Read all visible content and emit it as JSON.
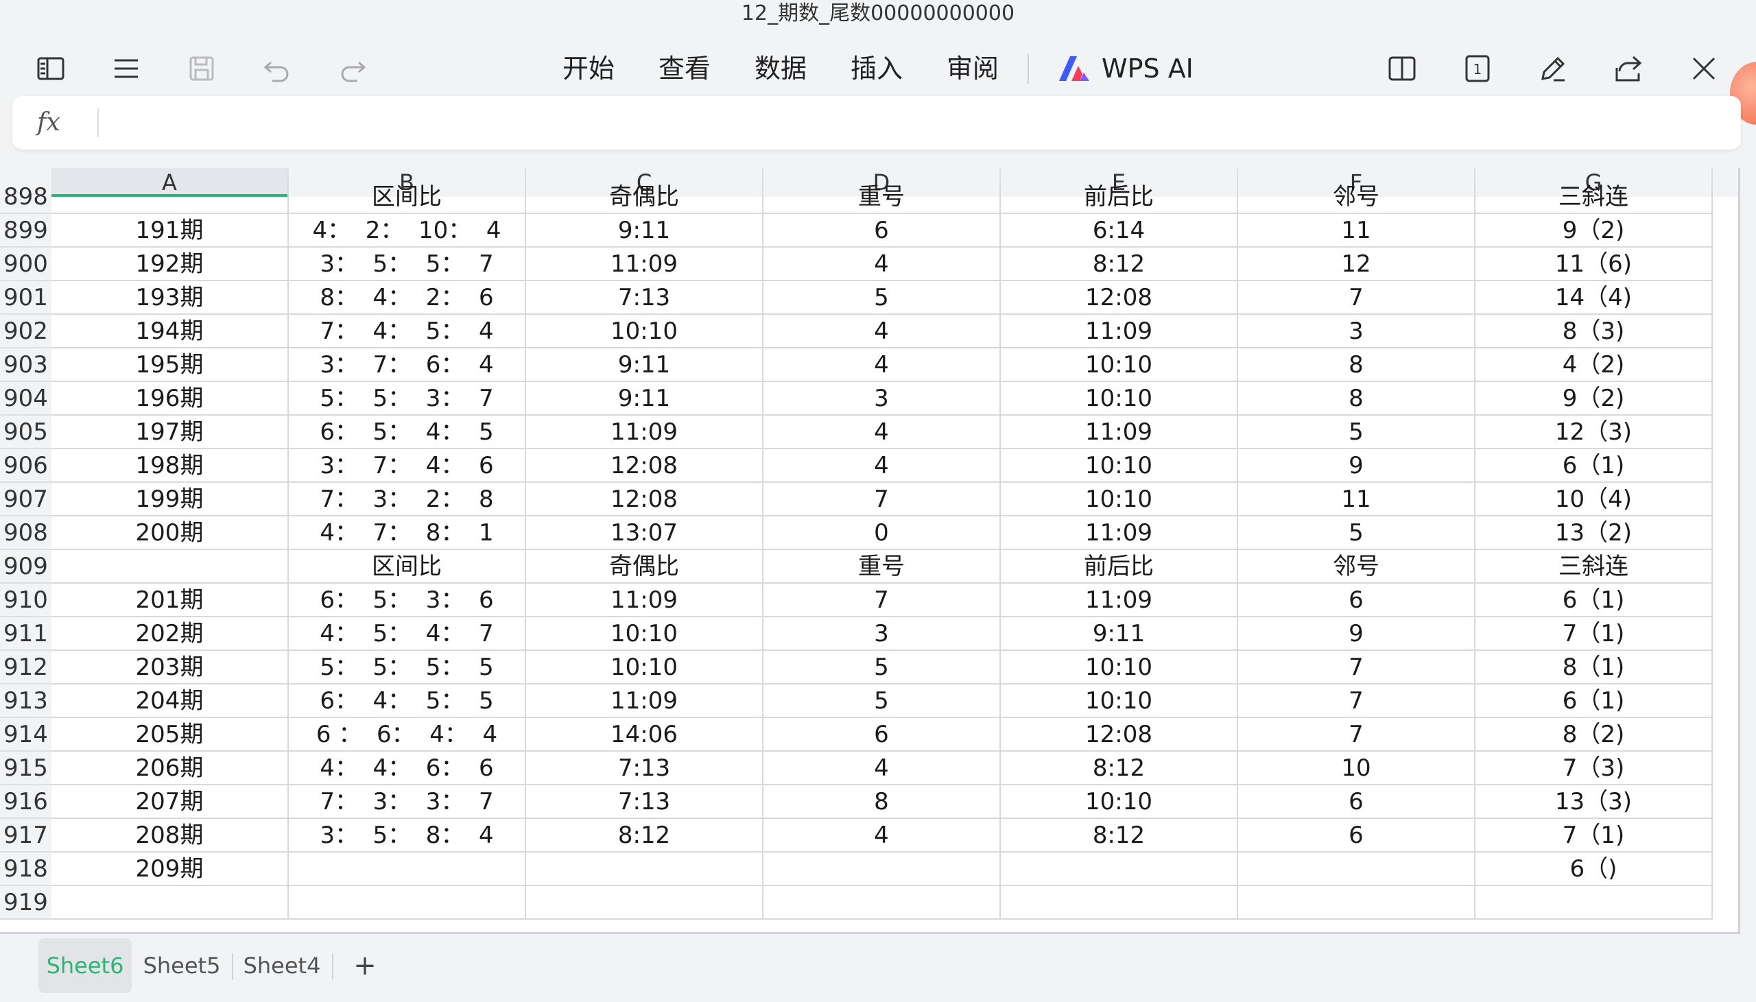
{
  "window": {
    "title": "12_期数_尾数00000000000"
  },
  "toolbar": {
    "menus": [
      "开始",
      "查看",
      "数据",
      "插入",
      "审阅"
    ],
    "ai_label": "WPS AI",
    "page_indicator": "1"
  },
  "formula": {
    "fx": "fx",
    "value": ""
  },
  "columns": [
    "A",
    "B",
    "C",
    "D",
    "E",
    "F",
    "G"
  ],
  "rows": [
    {
      "num": "898",
      "cells": [
        "",
        "区间比",
        "奇偶比",
        "重号",
        "前后比",
        "邻号",
        "三斜连"
      ]
    },
    {
      "num": "899",
      "cells": [
        "191期",
        "4：  2：  10：  4",
        "9:11",
        "6",
        "6:14",
        "11",
        "9（2)"
      ]
    },
    {
      "num": "900",
      "cells": [
        "192期",
        "3：  5：  5：  7",
        "11:09",
        "4",
        "8:12",
        "12",
        "11（6)"
      ]
    },
    {
      "num": "901",
      "cells": [
        "193期",
        "8：  4：  2：  6",
        "7:13",
        "5",
        "12:08",
        "7",
        "14（4)"
      ]
    },
    {
      "num": "902",
      "cells": [
        "194期",
        "7：  4：  5：  4",
        "10:10",
        "4",
        "11:09",
        "3",
        "8（3)"
      ]
    },
    {
      "num": "903",
      "cells": [
        "195期",
        "3：  7：  6：  4",
        "9:11",
        "4",
        "10:10",
        "8",
        "4（2)"
      ]
    },
    {
      "num": "904",
      "cells": [
        "196期",
        "5：  5：  3：  7",
        "9:11",
        "3",
        "10:10",
        "8",
        "9（2)"
      ]
    },
    {
      "num": "905",
      "cells": [
        "197期",
        "6：  5：  4：  5",
        "11:09",
        "4",
        "11:09",
        "5",
        "12（3)"
      ]
    },
    {
      "num": "906",
      "cells": [
        "198期",
        "3：  7：  4：  6",
        "12:08",
        "4",
        "10:10",
        "9",
        "6（1)"
      ]
    },
    {
      "num": "907",
      "cells": [
        "199期",
        "7：  3：  2：  8",
        "12:08",
        "7",
        "10:10",
        "11",
        "10（4)"
      ]
    },
    {
      "num": "908",
      "cells": [
        "200期",
        "4：  7：  8：  1",
        "13:07",
        "0",
        "11:09",
        "5",
        "13（2)"
      ]
    },
    {
      "num": "909",
      "cells": [
        "",
        "区间比",
        "奇偶比",
        "重号",
        "前后比",
        "邻号",
        "三斜连"
      ]
    },
    {
      "num": "910",
      "cells": [
        "201期",
        "6：  5：  3：  6",
        "11:09",
        "7",
        "11:09",
        "6",
        "6（1)"
      ]
    },
    {
      "num": "911",
      "cells": [
        "202期",
        "4：  5：  4：  7",
        "10:10",
        "3",
        "9:11",
        "9",
        "7（1)"
      ]
    },
    {
      "num": "912",
      "cells": [
        "203期",
        "5：  5：  5：  5",
        "10:10",
        "5",
        "10:10",
        "7",
        "8（1)"
      ]
    },
    {
      "num": "913",
      "cells": [
        "204期",
        "6：  4：  5：  5",
        "11:09",
        "5",
        "10:10",
        "7",
        "6（1)"
      ]
    },
    {
      "num": "914",
      "cells": [
        "205期",
        "6 ：  6：  4：  4",
        "14:06",
        "6",
        "12:08",
        "7",
        "8（2)"
      ]
    },
    {
      "num": "915",
      "cells": [
        "206期",
        "4：  4：  6：  6",
        "7:13",
        "4",
        "8:12",
        "10",
        "7（3)"
      ]
    },
    {
      "num": "916",
      "cells": [
        "207期",
        "7：  3：  3：  7",
        "7:13",
        "8",
        "10:10",
        "6",
        "13（3)"
      ]
    },
    {
      "num": "917",
      "cells": [
        "208期",
        "3：  5：  8：  4",
        "8:12",
        "4",
        "8:12",
        "6",
        "7（1)"
      ]
    },
    {
      "num": "918",
      "cells": [
        "209期",
        "",
        "",
        "",
        "",
        "",
        "6（)"
      ]
    },
    {
      "num": "919",
      "cells": [
        "",
        "",
        "",
        "",
        "",
        "",
        ""
      ]
    }
  ],
  "sheets": [
    "Sheet6",
    "Sheet5",
    "Sheet4"
  ],
  "add_sheet": "+",
  "colors": {
    "accent": "#2bb673",
    "ai_blue": "#3b5bff",
    "ai_red": "#ff3b5c"
  }
}
